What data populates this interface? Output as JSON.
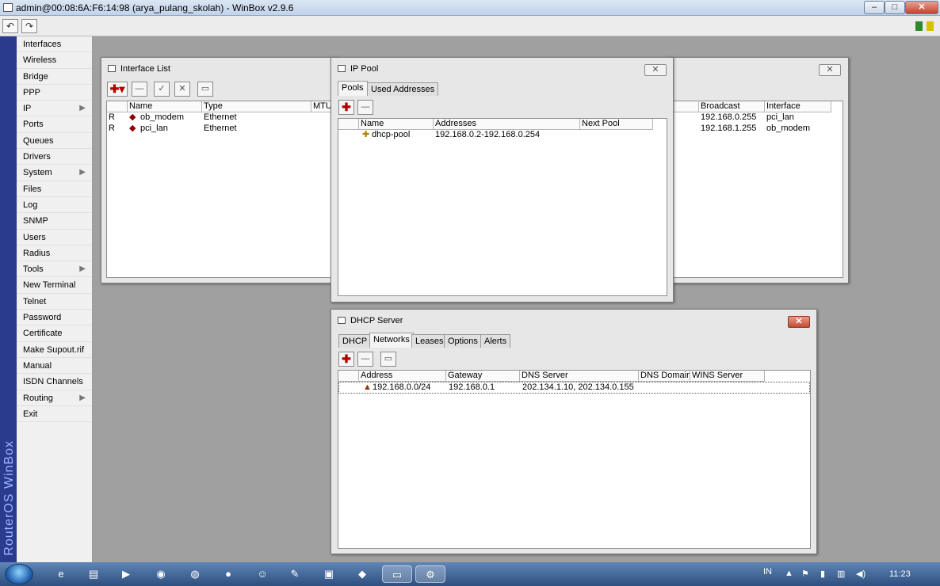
{
  "app": {
    "title": "admin@00:08:6A:F6:14:98 (arya_pulang_skolah) - WinBox v2.9.6",
    "brand": "RouterOS WinBox"
  },
  "window_controls": {
    "minimize": "–",
    "maximize": "□",
    "close": "✕"
  },
  "toolbar": {
    "undo": "↶",
    "redo": "↷"
  },
  "menu": [
    {
      "label": "Interfaces",
      "arrow": false
    },
    {
      "label": "Wireless",
      "arrow": false
    },
    {
      "label": "Bridge",
      "arrow": false
    },
    {
      "label": "PPP",
      "arrow": false
    },
    {
      "label": "IP",
      "arrow": true
    },
    {
      "label": "Ports",
      "arrow": false
    },
    {
      "label": "Queues",
      "arrow": false
    },
    {
      "label": "Drivers",
      "arrow": false
    },
    {
      "label": "System",
      "arrow": true
    },
    {
      "label": "Files",
      "arrow": false
    },
    {
      "label": "Log",
      "arrow": false
    },
    {
      "label": "SNMP",
      "arrow": false
    },
    {
      "label": "Users",
      "arrow": false
    },
    {
      "label": "Radius",
      "arrow": false
    },
    {
      "label": "Tools",
      "arrow": true
    },
    {
      "label": "New Terminal",
      "arrow": false
    },
    {
      "label": "Telnet",
      "arrow": false
    },
    {
      "label": "Password",
      "arrow": false
    },
    {
      "label": "Certificate",
      "arrow": false
    },
    {
      "label": "Make Supout.rif",
      "arrow": false
    },
    {
      "label": "Manual",
      "arrow": false
    },
    {
      "label": "ISDN Channels",
      "arrow": false
    },
    {
      "label": "Routing",
      "arrow": true
    },
    {
      "label": "Exit",
      "arrow": false
    }
  ],
  "interface_list": {
    "title": "Interface List",
    "columns": [
      "Name",
      "Type",
      "MTU"
    ],
    "rows": [
      {
        "flag": "R",
        "name": "ob_modem",
        "type": "Ethernet"
      },
      {
        "flag": "R",
        "name": "pci_lan",
        "type": "Ethernet"
      }
    ]
  },
  "address_window": {
    "columns": [
      "Broadcast",
      "Interface"
    ],
    "rows": [
      {
        "broadcast": "192.168.0.255",
        "interface": "pci_lan"
      },
      {
        "broadcast": "192.168.1.255",
        "interface": "ob_modem"
      }
    ]
  },
  "ip_pool": {
    "title": "IP Pool",
    "tabs": [
      "Pools",
      "Used Addresses"
    ],
    "columns": [
      "Name",
      "Addresses",
      "Next Pool"
    ],
    "rows": [
      {
        "name": "dhcp-pool",
        "addresses": "192.168.0.2-192.168.0.254",
        "next_pool": ""
      }
    ]
  },
  "dhcp_server": {
    "title": "DHCP Server",
    "tabs": [
      "DHCP",
      "Networks",
      "Leases",
      "Options",
      "Alerts"
    ],
    "active_tab": "Networks",
    "columns": [
      "Address",
      "Gateway",
      "DNS Server",
      "DNS Domain",
      "WINS Server"
    ],
    "rows": [
      {
        "address": "192.168.0.0/24",
        "gateway": "192.168.0.1",
        "dns_server": "202.134.1.10, 202.134.0.155",
        "dns_domain": "",
        "wins_server": ""
      }
    ]
  },
  "taskbar": {
    "lang": "IN",
    "time": "11:23"
  },
  "colors": {
    "sidebar": "#2a3a8c",
    "desktop": "#a0a0a0",
    "close_red": "#c54a33",
    "taskbar": "#2d4f7f"
  }
}
